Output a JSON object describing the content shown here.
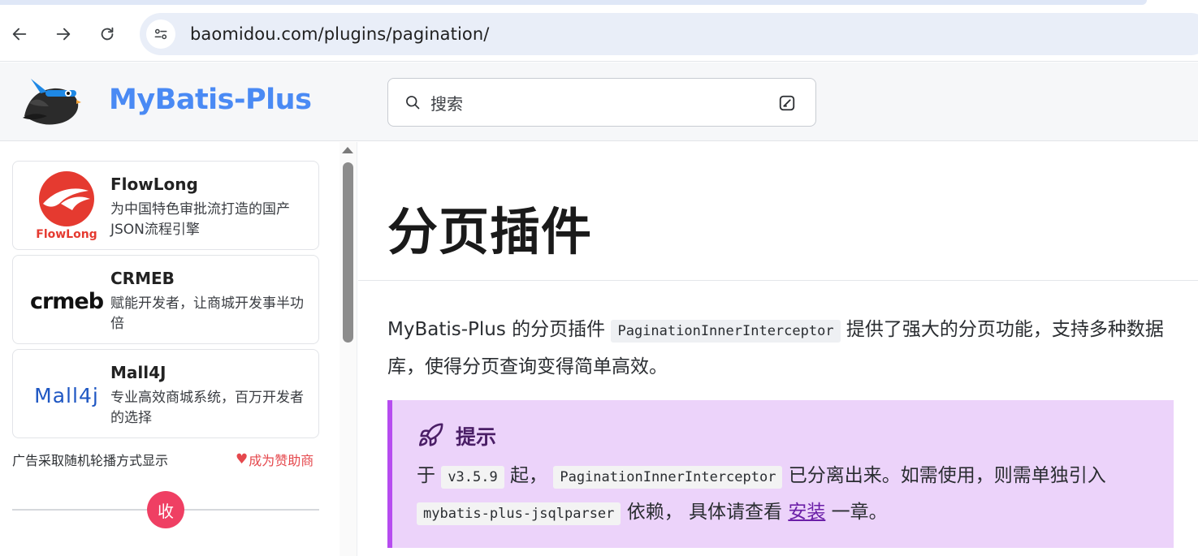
{
  "browser": {
    "url": "baomidou.com/plugins/pagination/",
    "nav": {
      "back": "back-arrow-icon",
      "forward": "forward-arrow-icon",
      "reload": "reload-icon",
      "site_info": "tune-icon"
    }
  },
  "header": {
    "brand": "MyBatis-Plus",
    "search_placeholder": "搜索",
    "brand_color": "#4a8af4"
  },
  "sidebar": {
    "ads": [
      {
        "title": "FlowLong",
        "desc": "为中国特色审批流打造的国产JSON流程引擎",
        "logo_text": "FlowLong"
      },
      {
        "title": "CRMEB",
        "desc": "赋能开发者，让商城开发事半功倍",
        "logo_text": "crmeb"
      },
      {
        "title": "Mall4J",
        "desc": "专业高效商城系统，百万开发者的选择",
        "logo_text": "Mall4j"
      }
    ],
    "ad_note": "广告采取随机轮播方式显示",
    "sponsor_label": "成为赞助商",
    "collapse_label": "收"
  },
  "main": {
    "title": "分页插件",
    "intro_pre": "MyBatis-Plus 的分页插件",
    "intro_code": "PaginationInnerInterceptor",
    "intro_post": "提供了强大的分页功能，支持多种数据库，使得分页查询变得简单高效。",
    "tip": {
      "title": "提示",
      "p1": "于",
      "code_version": "v3.5.9",
      "p2": "起，",
      "code_class": "PaginationInnerInterceptor",
      "p3": "已分离出来。如需使用，则需单独引入",
      "code_dep": "mybatis-plus-jsqlparser",
      "p4": "依赖，  具体请查看",
      "link": "安装",
      "p5": "一章。",
      "accent_color": "#b64cf0"
    }
  }
}
